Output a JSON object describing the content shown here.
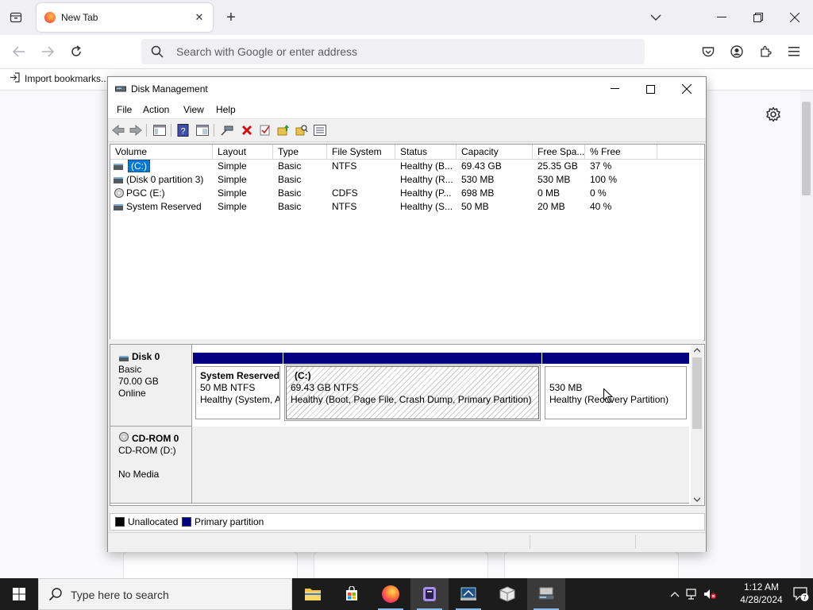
{
  "browser": {
    "tab_title": "New Tab",
    "url_placeholder": "Search with Google or enter address",
    "bookmark_label": "Import bookmarks..."
  },
  "disk_management": {
    "title": "Disk Management",
    "menu": [
      "File",
      "Action",
      "View",
      "Help"
    ],
    "columns": [
      "Volume",
      "Layout",
      "Type",
      "File System",
      "Status",
      "Capacity",
      "Free Spa...",
      "% Free"
    ],
    "volumes": [
      {
        "icon": "volume-icon",
        "volume": "(C:)",
        "layout": "Simple",
        "type": "Basic",
        "fs": "NTFS",
        "status": "Healthy (B...",
        "capacity": "69.43 GB",
        "free": "25.35 GB",
        "pct": "37 %"
      },
      {
        "icon": "volume-icon",
        "volume": "(Disk 0 partition 3)",
        "layout": "Simple",
        "type": "Basic",
        "fs": "",
        "status": "Healthy (R...",
        "capacity": "530 MB",
        "free": "530 MB",
        "pct": "100 %"
      },
      {
        "icon": "cd-icon",
        "volume": "PGC (E:)",
        "layout": "Simple",
        "type": "Basic",
        "fs": "CDFS",
        "status": "Healthy (P...",
        "capacity": "698 MB",
        "free": "0 MB",
        "pct": "0 %"
      },
      {
        "icon": "volume-icon",
        "volume": "System Reserved",
        "layout": "Simple",
        "type": "Basic",
        "fs": "NTFS",
        "status": "Healthy (S...",
        "capacity": "50 MB",
        "free": "20 MB",
        "pct": "40 %"
      }
    ],
    "disk0": {
      "name": "Disk 0",
      "type": "Basic",
      "size": "70.00 GB",
      "state": "Online",
      "partitions": [
        {
          "name": "System Reserved",
          "size": "50 MB NTFS",
          "status": "Healthy (System, A"
        },
        {
          "name": "(C:)",
          "size": "69.43 GB NTFS",
          "status": "Healthy (Boot, Page File, Crash Dump, Primary Partition)"
        },
        {
          "name": "",
          "size": "530 MB",
          "status": "Healthy (Recovery Partition)"
        }
      ]
    },
    "cdrom0": {
      "name": "CD-ROM 0",
      "drive": "CD-ROM (D:)",
      "media": "No Media"
    },
    "legend": {
      "unallocated": "Unallocated",
      "primary": "Primary partition",
      "unallocated_color": "#000000",
      "primary_color": "#000080"
    }
  },
  "taskbar": {
    "search_placeholder": "Type here to search",
    "time": "1:12 AM",
    "date": "4/28/2024",
    "notification_count": "7"
  }
}
